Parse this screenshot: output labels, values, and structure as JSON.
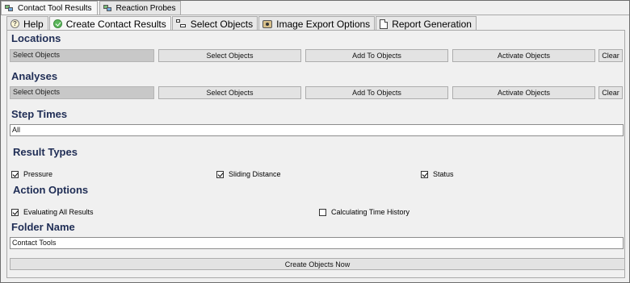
{
  "top_tabs": [
    {
      "label": "Contact Tool Results",
      "icon": "contact-tool-icon",
      "active": true
    },
    {
      "label": "Reaction Probes",
      "icon": "reaction-probe-icon",
      "active": false
    }
  ],
  "sub_tabs": [
    {
      "label": "Help",
      "icon": "help-icon"
    },
    {
      "label": "Create Contact Results",
      "icon": "check-circle-icon"
    },
    {
      "label": "Select Objects",
      "icon": "select-objects-icon"
    },
    {
      "label": "Image Export Options",
      "icon": "camera-icon"
    },
    {
      "label": "Report Generation",
      "icon": "document-icon"
    }
  ],
  "locations": {
    "heading": "Locations",
    "field_value": "Select Objects",
    "select_button": "Select Objects",
    "add_button": "Add To Objects",
    "activate_button": "Activate Objects",
    "clear_button": "Clear"
  },
  "analyses": {
    "heading": "Analyses",
    "field_value": "Select Objects",
    "select_button": "Select Objects",
    "add_button": "Add To Objects",
    "activate_button": "Activate Objects",
    "clear_button": "Clear"
  },
  "step_times": {
    "heading": "Step Times",
    "value": "All"
  },
  "result_types": {
    "heading": "Result Types",
    "items": [
      {
        "label": "Pressure",
        "checked": true
      },
      {
        "label": "Sliding Distance",
        "checked": true
      },
      {
        "label": "Status",
        "checked": true
      }
    ]
  },
  "action_options": {
    "heading": "Action Options",
    "items": [
      {
        "label": "Evaluating All Results",
        "checked": true
      },
      {
        "label": "Calculating Time History",
        "checked": false
      }
    ]
  },
  "folder": {
    "heading": "Folder Name",
    "value": "Contact Tools"
  },
  "create_button": "Create Objects Now"
}
